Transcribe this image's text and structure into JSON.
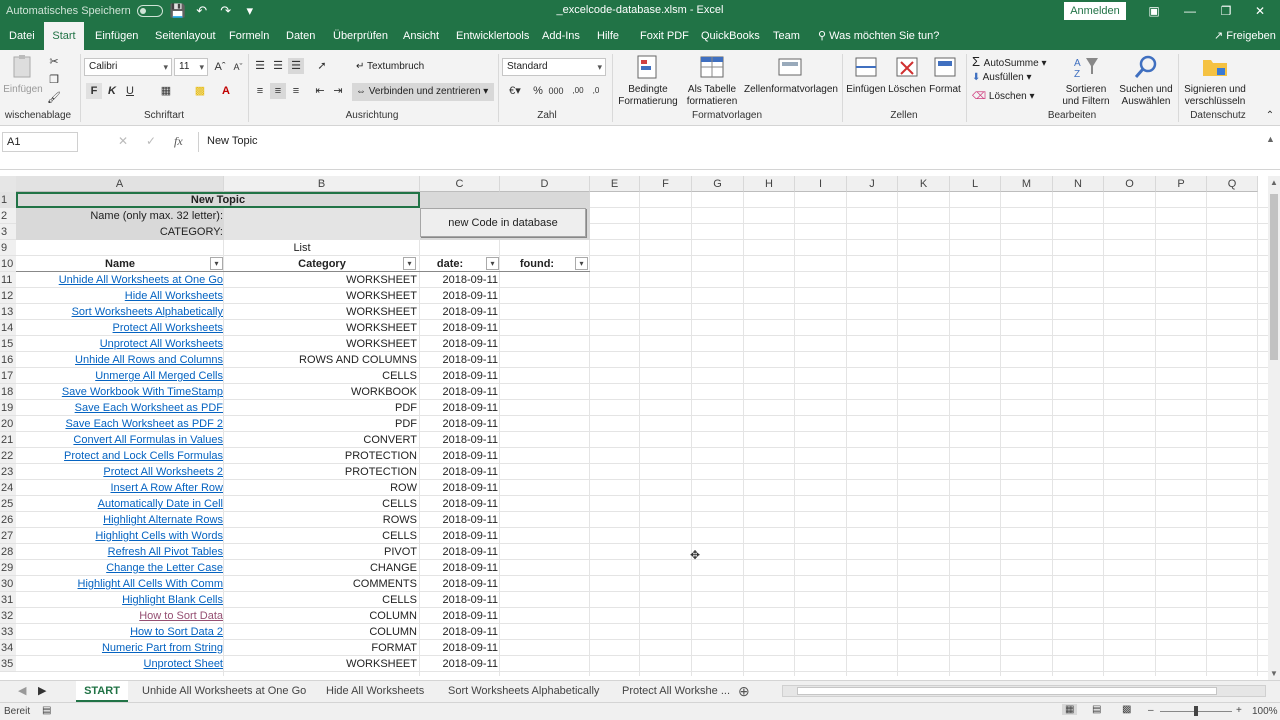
{
  "window": {
    "title": "_excelcode-database.xlsm  -  Excel",
    "autosave_label": "Automatisches Speichern",
    "login_label": "Anmelden"
  },
  "tabs": [
    "Datei",
    "Start",
    "Einfügen",
    "Seitenlayout",
    "Formeln",
    "Daten",
    "Überprüfen",
    "Ansicht",
    "Entwicklertools",
    "Add-Ins",
    "Hilfe",
    "Foxit PDF",
    "QuickBooks",
    "Team"
  ],
  "tell_me": "Was möchten Sie tun?",
  "share_label": "Freigeben",
  "ribbon": {
    "clipboard_paste": "Einfügen",
    "clipboard_group": "wischenablage",
    "font_name": "Calibri",
    "font_size": "11",
    "font_group": "Schriftart",
    "wrap_text": "Textumbruch",
    "merge_center": "Verbinden und zentrieren",
    "align_group": "Ausrichtung",
    "number_format": "Standard",
    "number_group": "Zahl",
    "cond_format": "Bedingte Formatierung",
    "as_table": "Als Tabelle formatieren",
    "cell_styles": "Zellenformatvorlagen",
    "styles_group": "Formatvorlagen",
    "insert": "Einfügen",
    "delete": "Löschen",
    "format": "Format",
    "cells_group": "Zellen",
    "autosum": "AutoSumme",
    "fill": "Ausfüllen",
    "clear": "Löschen",
    "sort_filter": "Sortieren und Filtern",
    "find_select": "Suchen und Auswählen",
    "editing_group": "Bearbeiten",
    "sign_encrypt": "Signieren und verschlüsseln",
    "protection_group": "Datenschutz",
    "bold": "F",
    "italic": "K",
    "underline": "U"
  },
  "formula_bar": {
    "name_box": "A1",
    "formula": "New Topic"
  },
  "columns": [
    "A",
    "B",
    "C",
    "D",
    "E",
    "F",
    "G",
    "H",
    "I",
    "J",
    "K",
    "L",
    "M",
    "N",
    "O",
    "P",
    "Q"
  ],
  "header_rows": {
    "title": "New Topic",
    "name_label": "Name (only max. 32 letter):",
    "category_label": "CATEGORY:",
    "button": "new Code in database",
    "list_label": "List",
    "col_name": "Name",
    "col_category": "Category",
    "col_date": "date:",
    "col_found": "found:"
  },
  "row_numbers_top": [
    "1",
    "2",
    "3",
    "9",
    "10"
  ],
  "rows": [
    {
      "n": "11",
      "name": "Unhide All Worksheets at One Go",
      "category": "WORKSHEET",
      "date": "2018-09-11"
    },
    {
      "n": "12",
      "name": "Hide All Worksheets",
      "category": "WORKSHEET",
      "date": "2018-09-11"
    },
    {
      "n": "13",
      "name": "Sort Worksheets Alphabetically",
      "category": "WORKSHEET",
      "date": "2018-09-11"
    },
    {
      "n": "14",
      "name": "Protect All Worksheets",
      "category": "WORKSHEET",
      "date": "2018-09-11"
    },
    {
      "n": "15",
      "name": "Unprotect All Worksheets",
      "category": "WORKSHEET",
      "date": "2018-09-11"
    },
    {
      "n": "16",
      "name": "Unhide All Rows and Columns",
      "category": "ROWS AND COLUMNS",
      "date": "2018-09-11"
    },
    {
      "n": "17",
      "name": "Unmerge All Merged Cells",
      "category": "CELLS",
      "date": "2018-09-11"
    },
    {
      "n": "18",
      "name": "Save Workbook With TimeStamp",
      "category": "WORKBOOK",
      "date": "2018-09-11"
    },
    {
      "n": "19",
      "name": "Save Each Worksheet as PDF",
      "category": "PDF",
      "date": "2018-09-11"
    },
    {
      "n": "20",
      "name": "Save Each Worksheet as PDF 2",
      "category": "PDF",
      "date": "2018-09-11"
    },
    {
      "n": "21",
      "name": "Convert All Formulas in Values",
      "category": "CONVERT",
      "date": "2018-09-11"
    },
    {
      "n": "22",
      "name": "Protect and Lock Cells Formulas",
      "category": "PROTECTION",
      "date": "2018-09-11"
    },
    {
      "n": "23",
      "name": "Protect All Worksheets 2",
      "category": "PROTECTION",
      "date": "2018-09-11"
    },
    {
      "n": "24",
      "name": "Insert A Row After Row",
      "category": "ROW",
      "date": "2018-09-11"
    },
    {
      "n": "25",
      "name": "Automatically Date in Cell",
      "category": "CELLS",
      "date": "2018-09-11"
    },
    {
      "n": "26",
      "name": "Highlight Alternate Rows",
      "category": "ROWS",
      "date": "2018-09-11"
    },
    {
      "n": "27",
      "name": "Highlight Cells with Words",
      "category": "CELLS",
      "date": "2018-09-11"
    },
    {
      "n": "28",
      "name": "Refresh All Pivot Tables",
      "category": "PIVOT",
      "date": "2018-09-11"
    },
    {
      "n": "29",
      "name": "Change the Letter Case",
      "category": "CHANGE",
      "date": "2018-09-11"
    },
    {
      "n": "30",
      "name": "Highlight All Cells With Comm",
      "category": "COMMENTS",
      "date": "2018-09-11"
    },
    {
      "n": "31",
      "name": "Highlight Blank Cells",
      "category": "CELLS",
      "date": "2018-09-11"
    },
    {
      "n": "32",
      "name": "How to Sort Data",
      "category": "COLUMN",
      "date": "2018-09-11",
      "visited": true
    },
    {
      "n": "33",
      "name": "How to Sort Data 2",
      "category": "COLUMN",
      "date": "2018-09-11"
    },
    {
      "n": "34",
      "name": "Numeric Part from String",
      "category": "FORMAT",
      "date": "2018-09-11"
    },
    {
      "n": "35",
      "name": "Unprotect Sheet",
      "category": "WORKSHEET",
      "date": "2018-09-11"
    }
  ],
  "sheet_tabs": [
    "START",
    "Unhide All Worksheets at One Go",
    "Hide All Worksheets",
    "Sort Worksheets Alphabetically",
    "Protect All Workshe ..."
  ],
  "status": {
    "ready": "Bereit",
    "zoom": "100%"
  },
  "colors": {
    "excel_green": "#217346",
    "link": "#0563c1",
    "visited": "#954f72"
  }
}
